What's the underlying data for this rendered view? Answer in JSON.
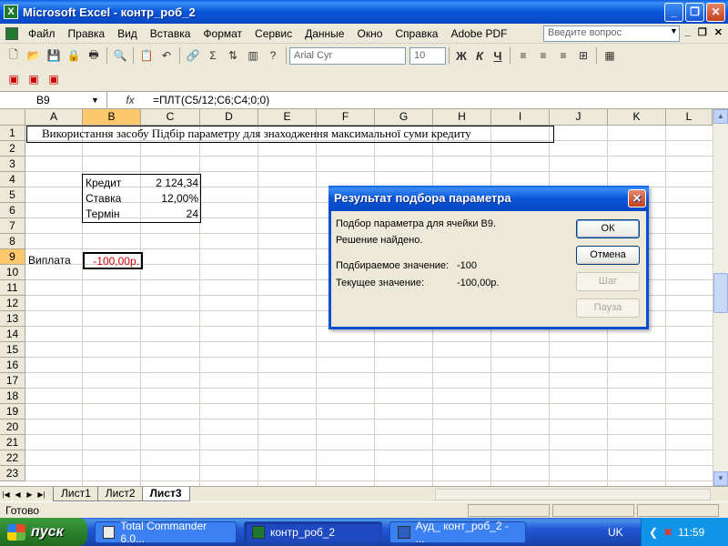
{
  "window": {
    "title": "Microsoft Excel - контр_роб_2"
  },
  "menu": {
    "items": [
      "Файл",
      "Правка",
      "Вид",
      "Вставка",
      "Формат",
      "Сервис",
      "Данные",
      "Окно",
      "Справка",
      "Adobe PDF"
    ],
    "help_placeholder": "Введите вопрос"
  },
  "toolbar": {
    "font": "Arial Cyr",
    "font_size": "10"
  },
  "formula_bar": {
    "cell_ref": "B9",
    "fx": "fx",
    "formula": "=ПЛТ(C5/12;C6;C4;0;0)"
  },
  "grid": {
    "columns": [
      "A",
      "B",
      "C",
      "D",
      "E",
      "F",
      "G",
      "H",
      "I",
      "J",
      "K",
      "L"
    ],
    "rows": [
      "1",
      "2",
      "3",
      "4",
      "5",
      "6",
      "7",
      "8",
      "9",
      "10",
      "11",
      "12",
      "13",
      "14",
      "15",
      "16",
      "17",
      "18",
      "19",
      "20",
      "21",
      "22",
      "23"
    ],
    "title_text": "Використання засобу Підбір параметру для знаходження максимальної суми кредиту",
    "labels": {
      "credit": "Кредит",
      "rate": "Ставка",
      "term": "Термін",
      "payment": "Виплата"
    },
    "values": {
      "credit": "2 124,34",
      "rate": "12,00%",
      "term": "24",
      "payment": "-100,00р."
    }
  },
  "sheets": {
    "tabs": [
      "Лист1",
      "Лист2",
      "Лист3"
    ],
    "active": "Лист3"
  },
  "status": {
    "text": "Готово"
  },
  "dialog": {
    "title": "Результат подбора параметра",
    "line1": "Подбор параметра для ячейки B9.",
    "line2": "Решение найдено.",
    "target_label": "Подбираемое значение:",
    "target_value": "-100",
    "current_label": "Текущее значение:",
    "current_value": "-100,00р.",
    "buttons": {
      "ok": "ОК",
      "cancel": "Отмена",
      "step": "Шаг",
      "pause": "Пауза"
    }
  },
  "taskbar": {
    "start": "пуск",
    "tasks": [
      "Total Commander 6.0...",
      "контр_роб_2",
      "Ауд_ конт_роб_2 - ..."
    ],
    "lang": "UK",
    "clock": "11:59"
  },
  "colors": {
    "selected_header": "#fbc86c",
    "payment_text": "#cc0000",
    "xp_blue": "#0a56d8"
  }
}
